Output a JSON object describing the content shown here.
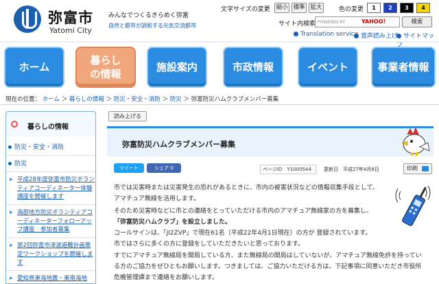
{
  "header": {
    "city_name": "弥富市",
    "city_name_en": "Yatomi City",
    "tagline1": "みんなでつくるきらめく弥富",
    "tagline2": "自然と都市が調和する元気交流都市",
    "font_size_label": "文字サイズの変更",
    "font_small": "縮小",
    "font_standard": "標準",
    "font_large": "拡大",
    "color_label": "色の変更",
    "colors": [
      "1",
      "2",
      "3",
      "4"
    ],
    "search_label": "サイト内検索",
    "search_placeholder": "POWERED BY",
    "search_brand": "YAHOO!",
    "search_button": "検索",
    "links": [
      "Translation service",
      "音声読み上げ",
      "サイトマップ"
    ]
  },
  "nav": [
    {
      "label": "ホーム",
      "active": false
    },
    {
      "label": "暮らし\nの情報",
      "active": true
    },
    {
      "label": "施設案内",
      "active": false
    },
    {
      "label": "市政情報",
      "active": false
    },
    {
      "label": "イベント",
      "active": false
    },
    {
      "label": "事業者情報",
      "active": false
    }
  ],
  "breadcrumb": {
    "prefix": "現在の位置：",
    "items": [
      "ホーム",
      "暮らしの情報",
      "防災・安全・消防",
      "防災"
    ],
    "current": "弥富防災ハムクラブメンバー募集"
  },
  "sidebar": {
    "title": "暮らしの情報",
    "items": [
      "防災・安全・消防",
      "防災"
    ],
    "subitems": [
      "平成28年度弥富市防災ボランティアコーディネーター体験講座を開催します",
      "海部地方防災ボランティアコーディネーターフォローアップ講座　参加者募集",
      "第2回弥富市津波避難計画策定ワークショップを開催します",
      "愛知県東海地震・東南海地"
    ]
  },
  "content": {
    "read_aloud": "読み上げる",
    "title": "弥富防災ハムクラブメンバー募集",
    "tweet": "ツイート",
    "share": "シェア 0",
    "page_id_label": "ページID",
    "page_id": "Y1000544",
    "updated_label": "更新日",
    "updated": "平成27年4月8日",
    "print": "印刷",
    "lines": [
      "市では災害時または災害発生の恐れがあるときに、市内の被害状況などの情報収集手段として、",
      "アマチュア無線を活用します。",
      "そのため災害時などに市との連絡をとっていただける市内のアマチュア無線家の方を募集し、",
      "「弥富防災ハムクラブ」を設立しました。",
      "コールサインは、「JI2ZVP」で現在61名（平成22年4月1日現在）の方が 登録されています。",
      "市ではさらに多くの方に登録をしていただきたいと思っております。",
      "すでにアマチュア無線局を開局している方、また無線局の開局はしていないが、アマチュア無線免許を持ってい",
      "る方のご協力をぜひともお願いします。つきましては、ご協力いただける方は、下記事項に同意いただき市役所",
      "危機管理課まで連絡をお願いします。"
    ]
  },
  "colors": {
    "accent": "#2a8be0",
    "active_tab": "#f0a77c",
    "link": "#1b5fae"
  }
}
